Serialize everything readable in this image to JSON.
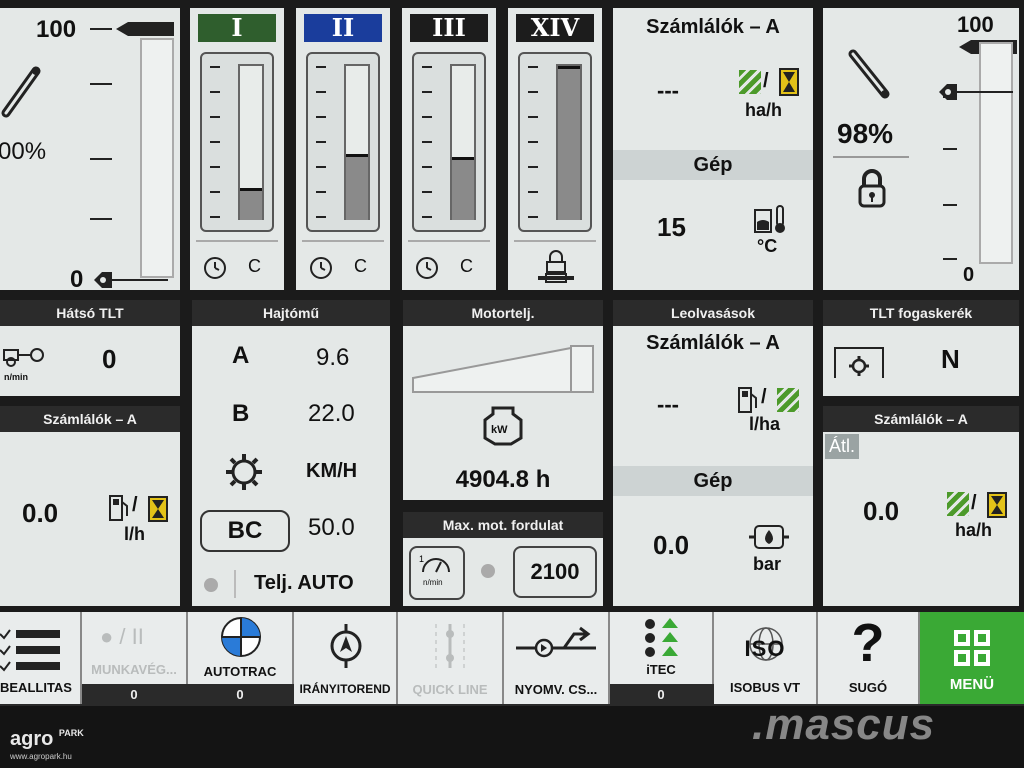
{
  "top_row": {
    "rear_hitch": {
      "top_value": "100",
      "bottom_value": "0",
      "percent": "00%"
    },
    "gauges": [
      {
        "roman": "I",
        "color": "#2f5e2d",
        "level": 0.2,
        "footer_c": "C"
      },
      {
        "roman": "II",
        "color": "#1a3d9c",
        "level": 0.42,
        "footer_c": "C"
      },
      {
        "roman": "III",
        "color": "#1c1c1c",
        "level": 0.4,
        "footer_c": "C"
      },
      {
        "roman": "XIV",
        "color": "#1c1c1c",
        "level": 1.0
      }
    ],
    "readout_top": {
      "title": "Számlálók – A",
      "value": "---",
      "unit": "ha/h",
      "sub_title": "Gép",
      "sub_value": "15",
      "sub_unit": "°C"
    },
    "front_hitch": {
      "top_value": "100",
      "bottom_value": "0",
      "percent": "98%"
    }
  },
  "mid_row": {
    "rear_pto": {
      "header": "Hátsó TLT",
      "unit": "n/min",
      "value": "0"
    },
    "counters_left": {
      "header": "Számlálók – A",
      "value": "0.0",
      "unit": "l/h"
    },
    "transmission": {
      "header": "Hajtómű",
      "rows": [
        {
          "label": "A",
          "value": "9.6"
        },
        {
          "label": "B",
          "value": "22.0"
        },
        {
          "label": "",
          "value": "KM/H"
        },
        {
          "label": "BC",
          "value": "50.0"
        }
      ],
      "footer": "Telj. AUTO"
    },
    "engine_power": {
      "header": "Motortelj.",
      "icon_text": "kW",
      "hours": "4904.8 h"
    },
    "max_rpm": {
      "header": "Max. mot. fordulat",
      "icon_unit": "n/min",
      "value": "2100"
    },
    "readings": {
      "header": "Leolvasások",
      "title": "Számlálók – A",
      "value": "---",
      "unit": "l/ha",
      "sub_title": "Gép",
      "sub_value": "0.0",
      "sub_unit": "bar"
    },
    "pto_gear": {
      "header": "TLT fogaskerék",
      "value": "N"
    },
    "counters_right": {
      "header": "Számlálók – A",
      "tag": "Átl.",
      "value": "0.0",
      "unit": "ha/h"
    }
  },
  "toolbar": [
    {
      "id": "beallitas",
      "label": "BEALLITAS",
      "badge": ""
    },
    {
      "id": "munkaveg",
      "label": "MUNKAVÉG...",
      "badge": "0",
      "dim": true
    },
    {
      "id": "autotrac",
      "label": "AUTOTRAC",
      "badge": "0"
    },
    {
      "id": "iranyito",
      "label": "IRÁNYITOREND",
      "badge": ""
    },
    {
      "id": "quickline",
      "label": "QUICK LINE",
      "badge": "",
      "dim": true
    },
    {
      "id": "nyomv",
      "label": "NYOMV. CS...",
      "badge": ""
    },
    {
      "id": "itec",
      "label": "iTEC",
      "badge": "0"
    },
    {
      "id": "isobus",
      "label": "ISOBUS VT",
      "badge": ""
    },
    {
      "id": "sugo",
      "label": "SUGÓ",
      "badge": ""
    },
    {
      "id": "menu",
      "label": "MENÜ",
      "badge": ""
    }
  ],
  "isobus_logo_text": "ISO",
  "watermark": {
    "left": "agro",
    "left_small": "PARK",
    "left_url": "www.agropark.hu",
    "right": ".mascus"
  },
  "colors": {
    "menu_green": "#3aa935",
    "hatch_green": "#4c9a2a",
    "hourglass_yellow": "#e3c218"
  }
}
